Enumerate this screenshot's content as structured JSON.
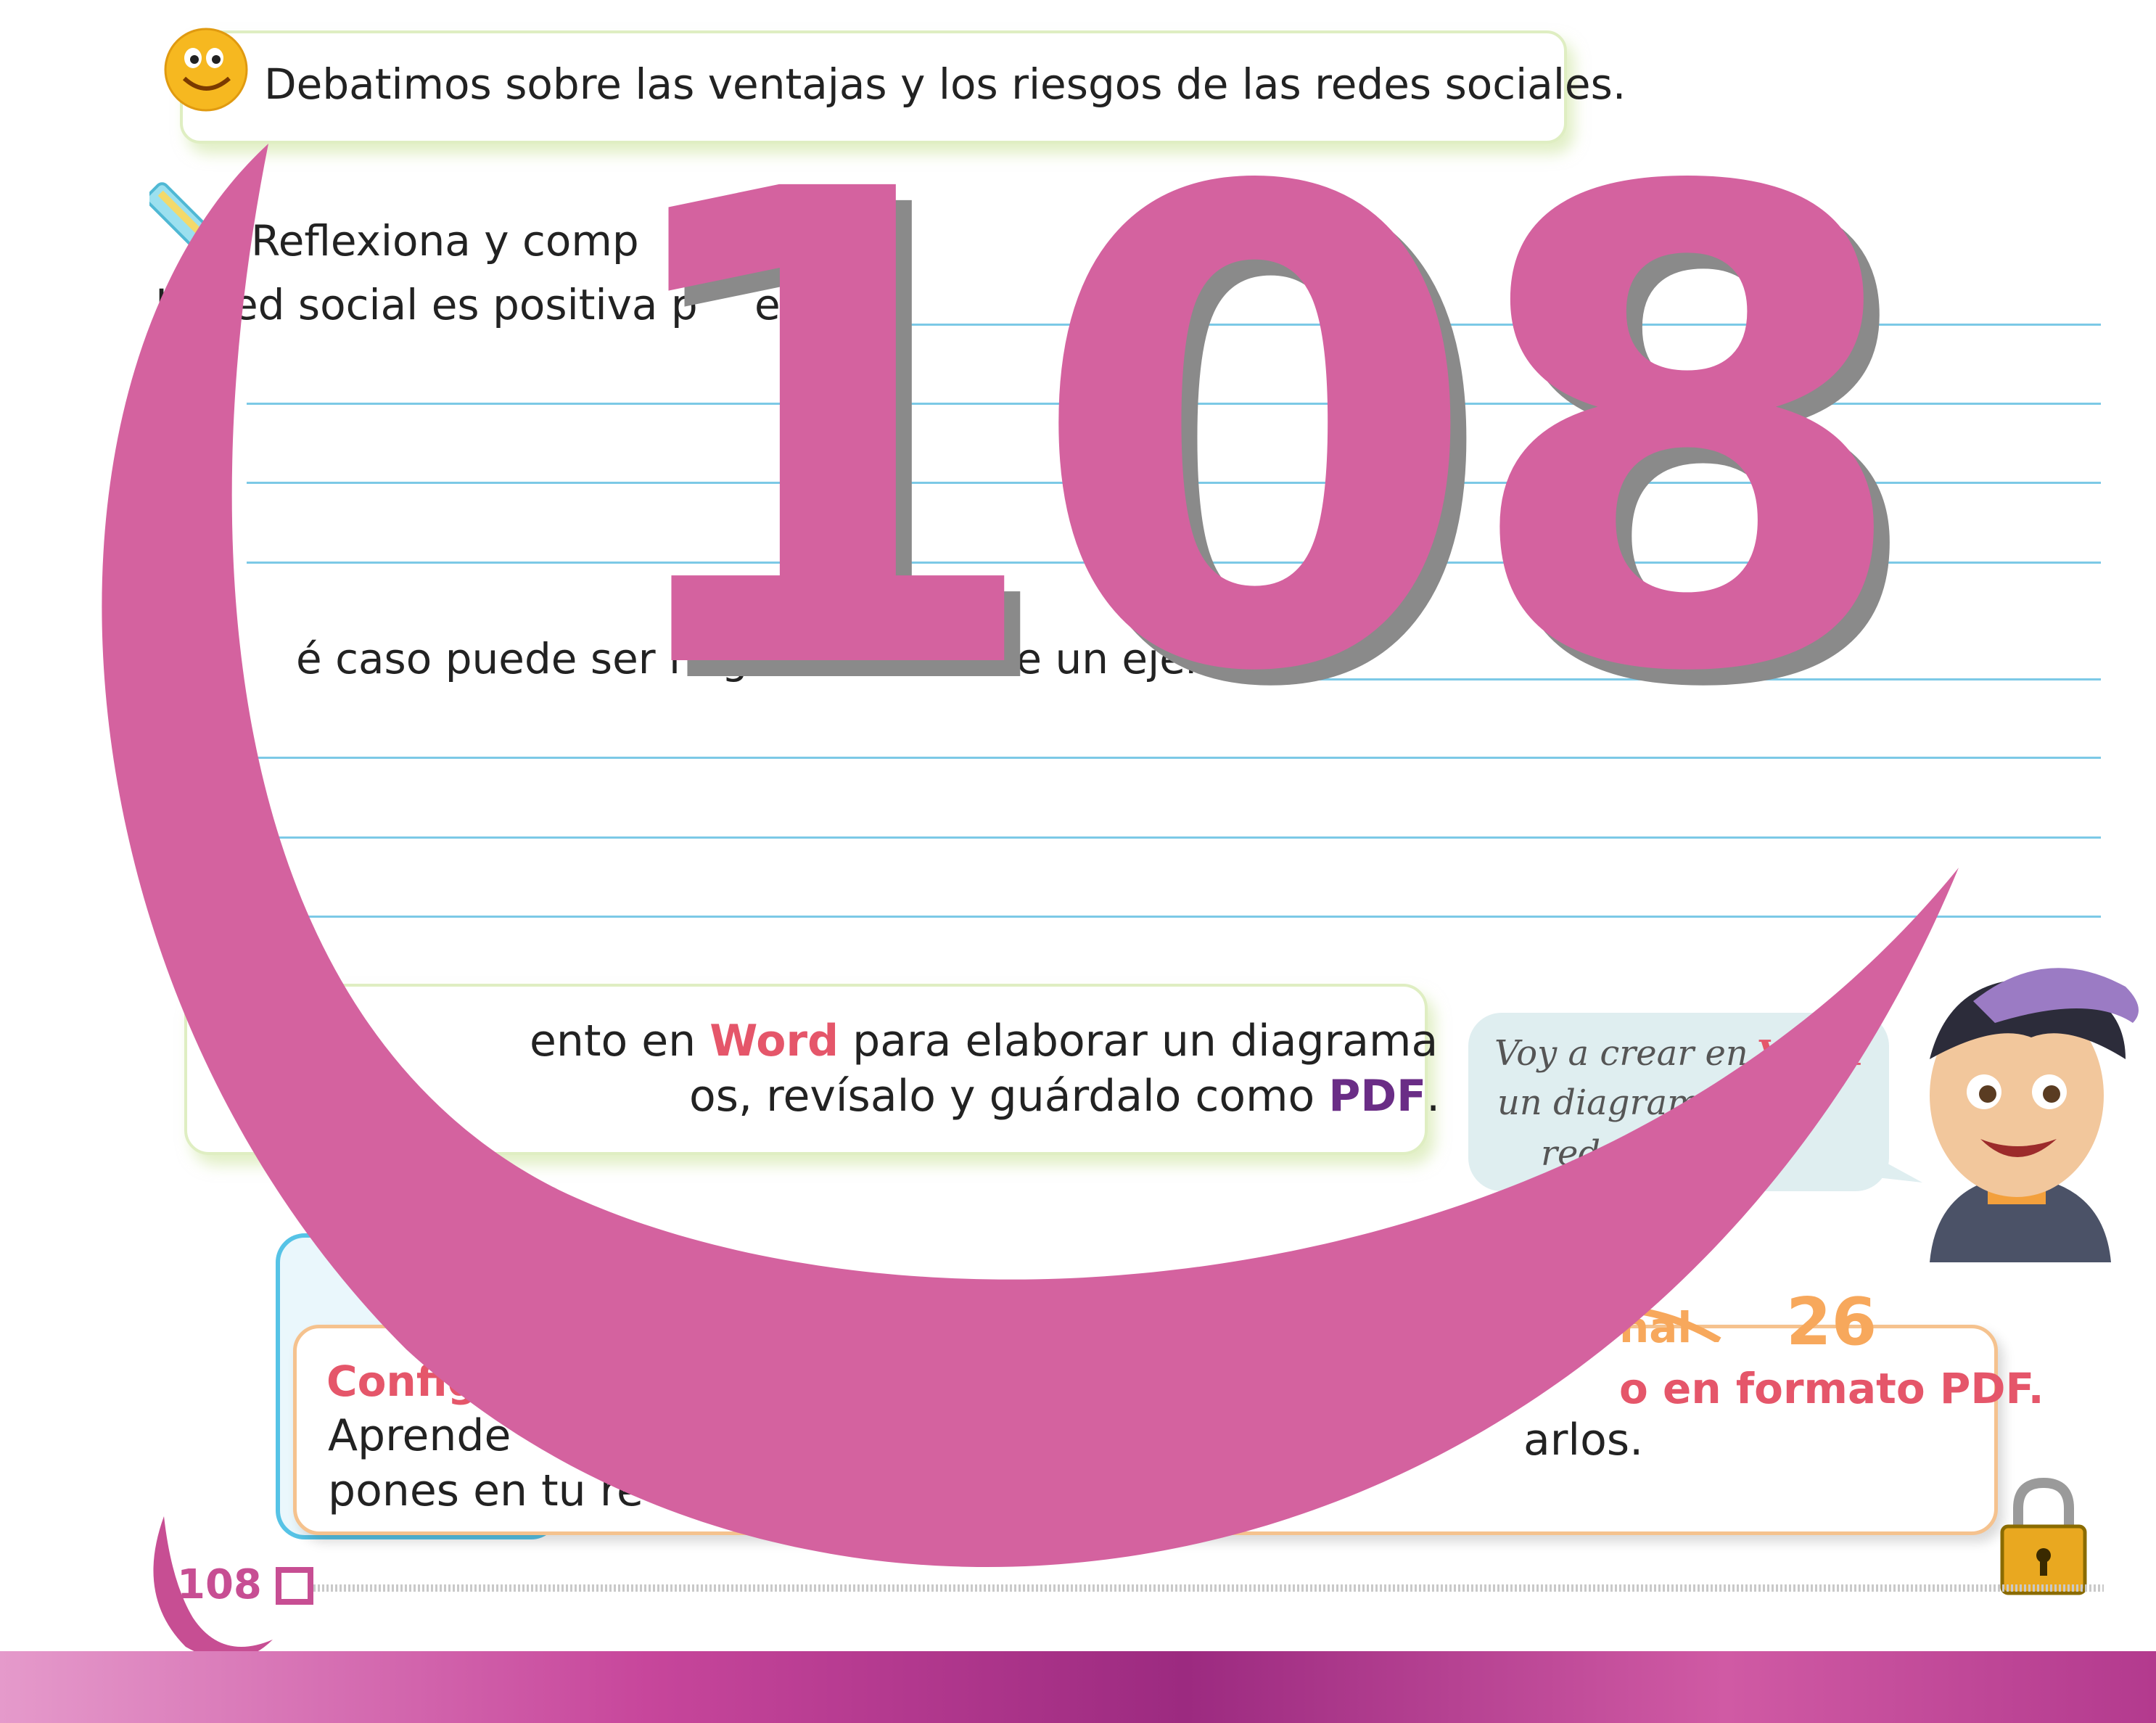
{
  "header": {
    "text": "Debatimos sobre las ventajas y los riesgos de las redes sociales."
  },
  "exercise": {
    "instruction": "Reflexiona y comp",
    "q1_prefix": "L",
    "q1_rest": "ed social es positiva p",
    "q1_end": "e:",
    "q2": "é caso puede ser negativa? Escribe un ejemplo."
  },
  "task": {
    "line1_a": "ento en ",
    "line1_word": "Word",
    "line1_b": " para elaborar un diagrama",
    "line2_a": "os, revísalo y guárdalo como ",
    "line2_pdf": "PDF",
    "line2_b": "."
  },
  "bubble": {
    "line1_a": "Voy a crear en ",
    "line1_word": "Word",
    "line2": "un diagrama co",
    "line3": "red de"
  },
  "config": {
    "title": "Config",
    "title_right": "o en formato PDF.",
    "line1_a": "Aprende",
    "line1_b": "arlos.",
    "line2": "pones en tu re",
    "tag_text": "nal",
    "number": "26"
  },
  "footer": {
    "page_number": "108"
  },
  "overlay": {
    "number": "108"
  },
  "colors": {
    "accent_pink": "#d4629f",
    "word_red": "#e5566a",
    "pdf_purple": "#6a2d86"
  }
}
